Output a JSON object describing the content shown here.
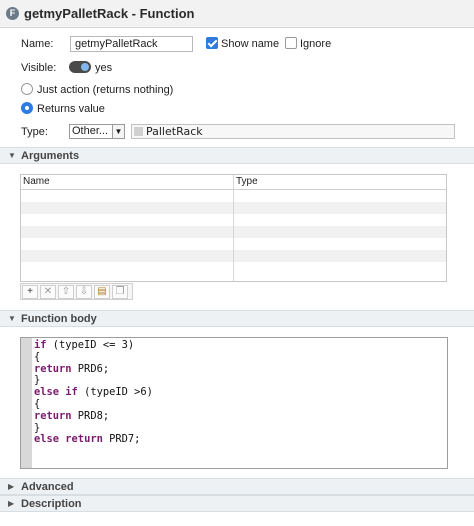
{
  "window": {
    "title": "getmyPalletRack - Function",
    "icon": "F"
  },
  "form": {
    "name_label": "Name:",
    "name_value": "getmyPalletRack",
    "show_name_label": "Show name",
    "show_name_checked": true,
    "ignore_label": "Ignore",
    "ignore_checked": false,
    "visible_label": "Visible:",
    "visible_value": "yes",
    "just_action_label": "Just action (returns nothing)",
    "returns_value_label": "Returns value",
    "type_label": "Type:",
    "type_select_value": "Other...",
    "type_value": "PalletRack"
  },
  "sections": {
    "arguments": "Arguments",
    "function_body": "Function body",
    "advanced": "Advanced",
    "description": "Description"
  },
  "arguments_table": {
    "columns": [
      "Name",
      "Type"
    ],
    "rows": []
  },
  "toolbar": {
    "buttons": [
      "add-icon",
      "delete-icon",
      "move-up-icon",
      "move-down-icon",
      "paste-icon",
      "copy-icon"
    ]
  },
  "code": {
    "lines": [
      "if (typeID <= 3)",
      "{",
      "return PRD6;",
      "}",
      "else if (typeID >6)",
      "{",
      "return PRD8;",
      "}",
      "else return PRD7;"
    ]
  }
}
